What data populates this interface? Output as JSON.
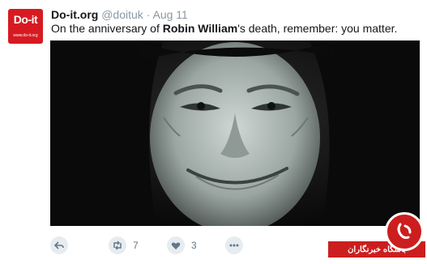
{
  "tweet": {
    "avatar": {
      "logo_text": "Do-it",
      "logo_subtext": "www.do-it.org",
      "color": "#d71a21"
    },
    "author_name": "Do-it.org",
    "handle": "@doituk",
    "separator": "·",
    "date": "Aug 11",
    "text_before": "On the anniversary of ",
    "text_bold": "Robin William",
    "text_after": "'s death, remember: you matter.",
    "actions": [
      {
        "name": "reply",
        "icon": "reply-icon",
        "count": ""
      },
      {
        "name": "retweet",
        "icon": "retweet-icon",
        "count": "7"
      },
      {
        "name": "like",
        "icon": "heart-icon",
        "count": "3"
      },
      {
        "name": "more",
        "icon": "more-dots-icon",
        "count": ""
      }
    ]
  },
  "watermark": {
    "label": "باشگاه خبرنگاران",
    "color": "#cc1e1e"
  }
}
